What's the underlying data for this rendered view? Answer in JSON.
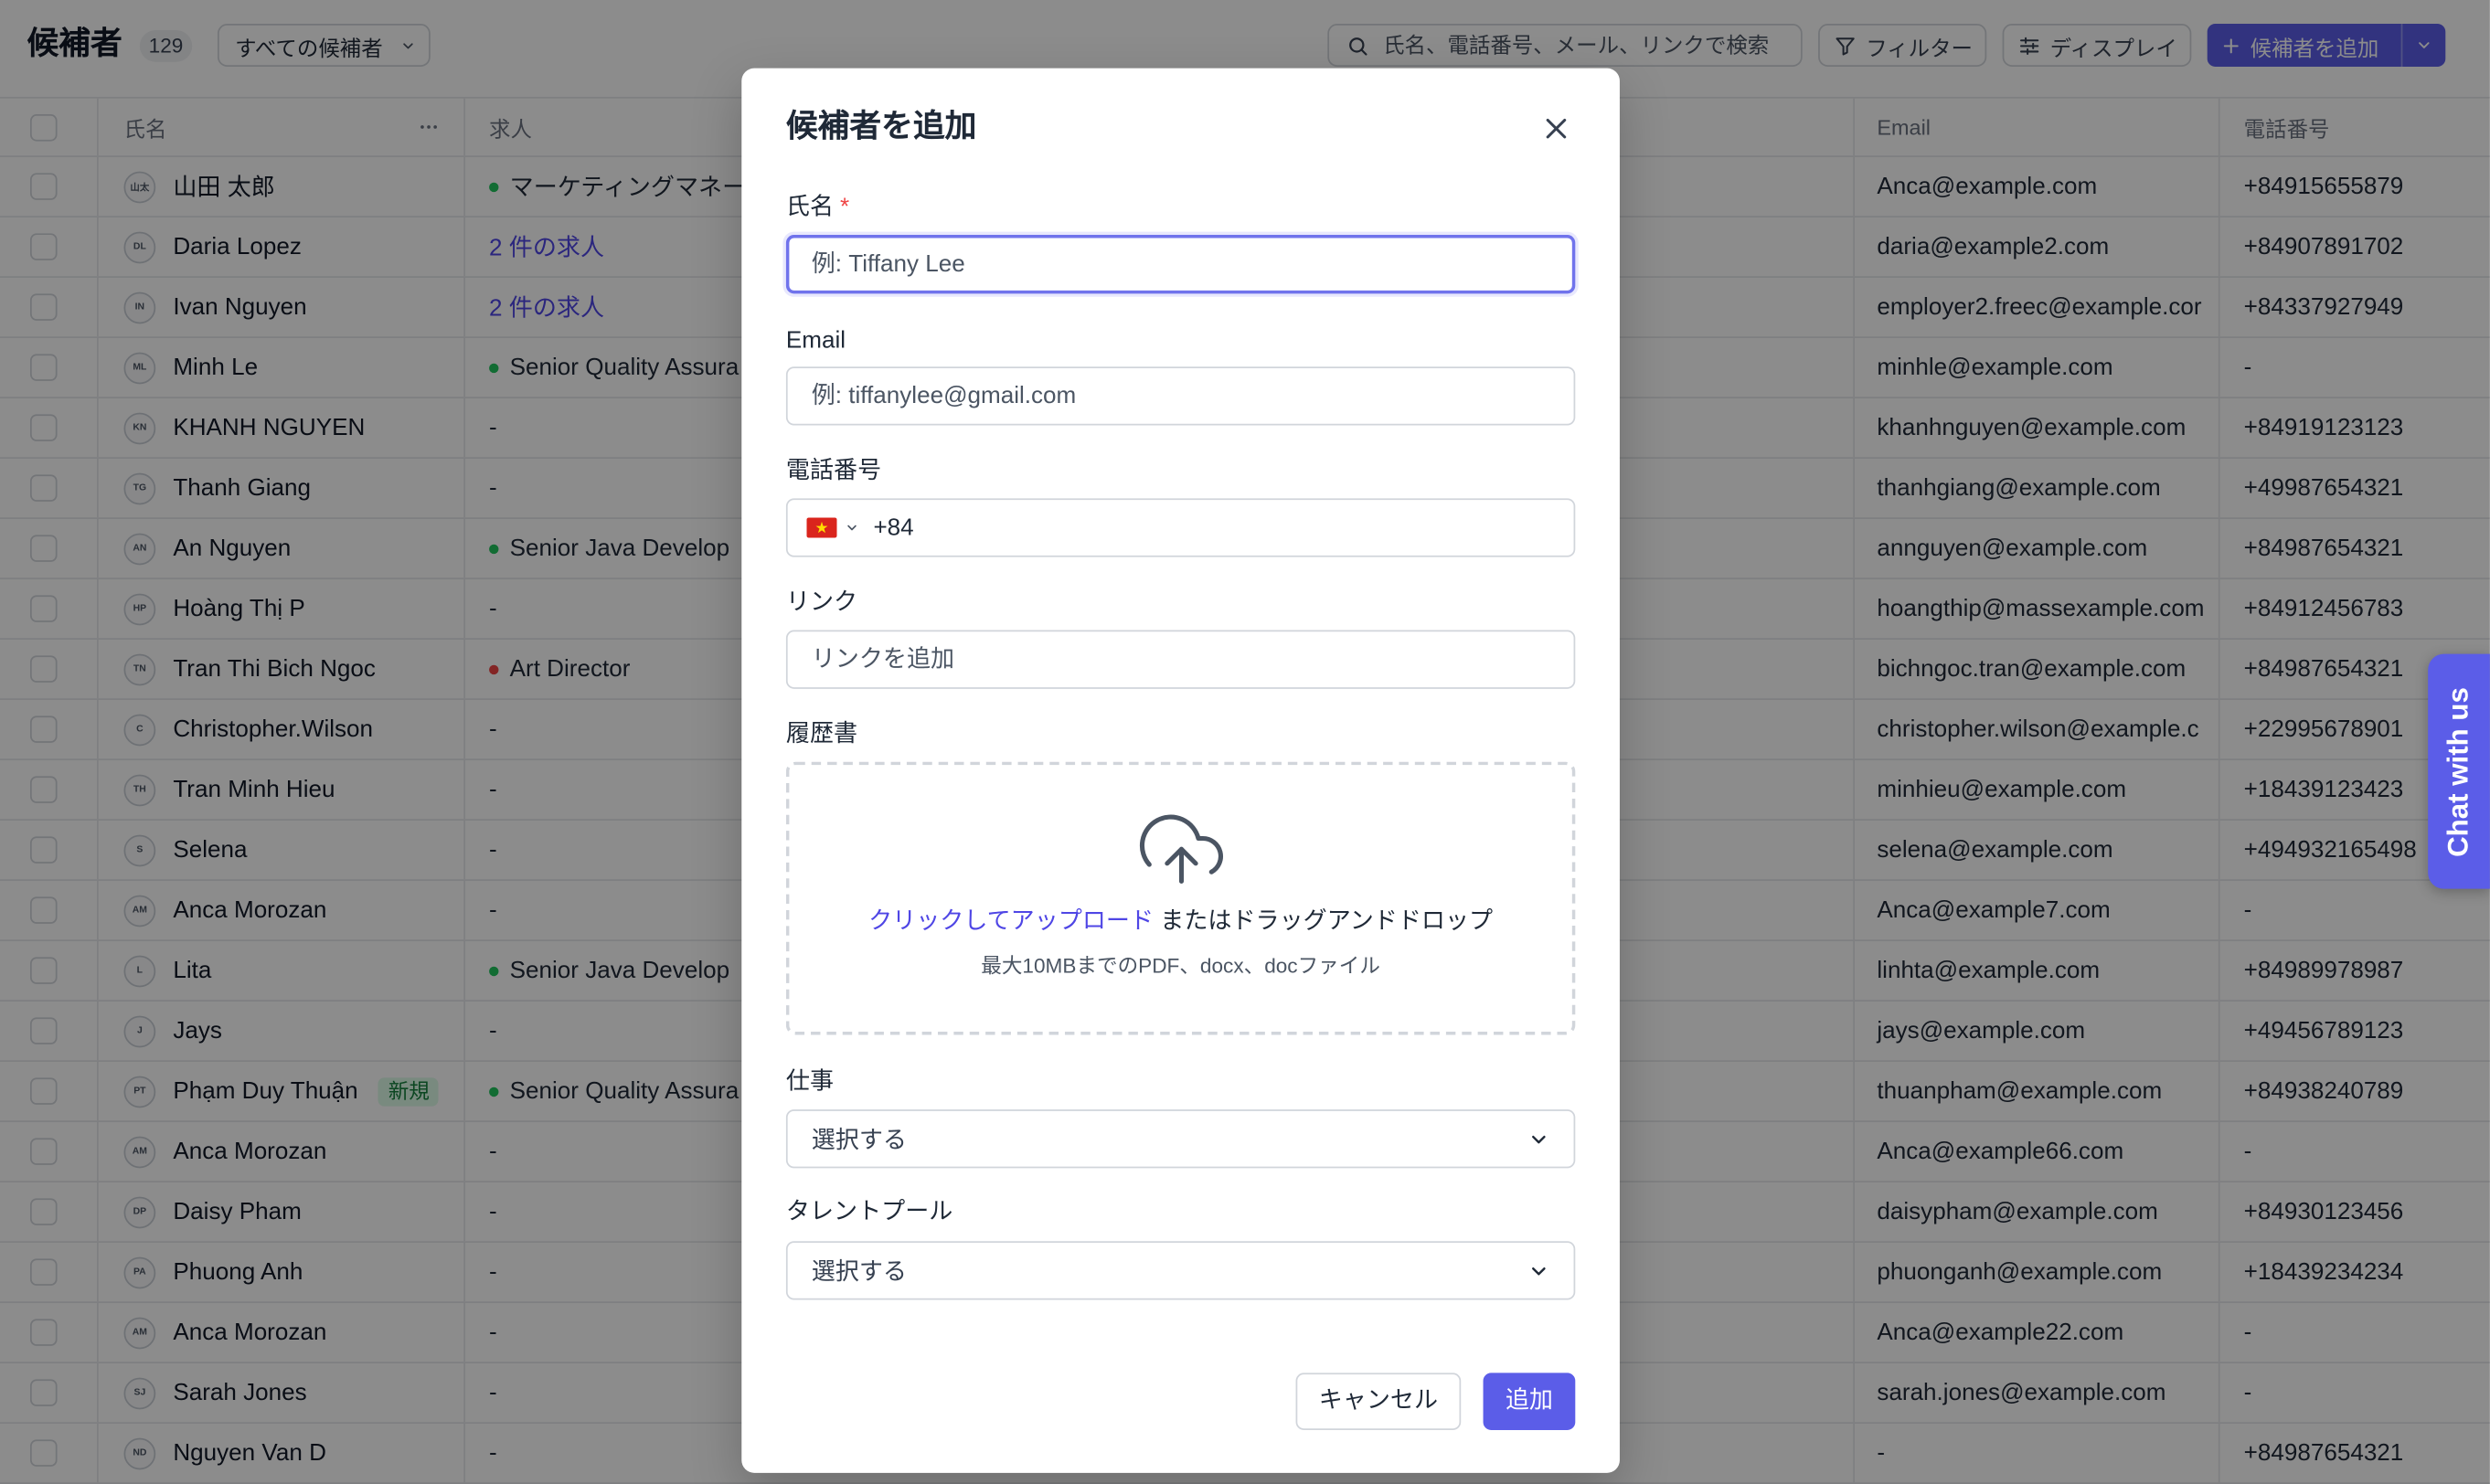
{
  "colors": {
    "accent": "#5b5de8"
  },
  "header": {
    "title": "候補者",
    "count": "129",
    "view_select": "すべての候補者",
    "search_placeholder": "氏名、電話番号、メール、リンクで検索",
    "filter_label": "フィルター",
    "display_label": "ディスプレイ",
    "add_label": "候補者を追加"
  },
  "table": {
    "columns": {
      "name": "氏名",
      "job": "求人",
      "email": "Email",
      "phone": "電話番号"
    },
    "rows": [
      {
        "initials": "山太",
        "name": "山田 太郎",
        "job": "マーケティングマネー",
        "job_dot": "#22c55e",
        "email": "Anca@example.com",
        "phone": "+84915655879"
      },
      {
        "initials": "DL",
        "name": "Daria Lopez",
        "job": "2 件の求人",
        "job_color": "#4f46e5",
        "email": "daria@example2.com",
        "phone": "+84907891702"
      },
      {
        "initials": "IN",
        "name": "Ivan Nguyen",
        "job": "2 件の求人",
        "job_color": "#4f46e5",
        "email": "employer2.freec@example.cor",
        "phone": "+84337927949"
      },
      {
        "initials": "ML",
        "name": "Minh Le",
        "job": "Senior Quality Assura",
        "job_dot": "#22c55e",
        "email": "minhle@example.com",
        "phone": "-"
      },
      {
        "initials": "KN",
        "name": "KHANH NGUYEN",
        "job": "-",
        "email": "khanhnguyen@example.com",
        "phone": "+84919123123"
      },
      {
        "initials": "TG",
        "name": "Thanh Giang",
        "job": "-",
        "email": "thanhgiang@example.com",
        "phone": "+49987654321"
      },
      {
        "initials": "AN",
        "name": "An Nguyen",
        "job": "Senior Java Develop",
        "job_dot": "#22c55e",
        "email": "annguyen@example.com",
        "phone": "+84987654321"
      },
      {
        "initials": "HP",
        "name": "Hoàng Thị P",
        "job": "-",
        "email": "hoangthip@massexample.com",
        "phone": "+84912456783"
      },
      {
        "initials": "TN",
        "name": "Tran Thi Bich Ngoc",
        "job": "Art Director",
        "job_dot": "#ef4444",
        "email": "bichngoc.tran@example.com",
        "phone": "+84987654321"
      },
      {
        "initials": "C",
        "name": "Christopher.Wilson",
        "job": "-",
        "email": "christopher.wilson@example.c",
        "phone": "+22995678901"
      },
      {
        "initials": "TH",
        "name": "Tran Minh Hieu",
        "job": "-",
        "email": "minhieu@example.com",
        "phone": "+18439123423"
      },
      {
        "initials": "S",
        "name": "Selena",
        "job": "-",
        "email": "selena@example.com",
        "phone": "+494932165498"
      },
      {
        "initials": "AM",
        "name": "Anca Morozan",
        "job": "-",
        "email": "Anca@example7.com",
        "phone": "-"
      },
      {
        "initials": "L",
        "name": "Lita",
        "job": "Senior Java Develop",
        "job_dot": "#22c55e",
        "email": "linhta@example.com",
        "phone": "+84989978987"
      },
      {
        "initials": "J",
        "name": "Jays",
        "job": "-",
        "email": "jays@example.com",
        "phone": "+49456789123"
      },
      {
        "initials": "PT",
        "name": "Phạm Duy Thuận",
        "badge": "新規",
        "job": "Senior Quality Assura",
        "job_dot": "#22c55e",
        "email": "thuanpham@example.com",
        "phone": "+84938240789"
      },
      {
        "initials": "AM",
        "name": "Anca Morozan",
        "job": "-",
        "email": "Anca@example66.com",
        "phone": "-"
      },
      {
        "initials": "DP",
        "name": "Daisy Pham",
        "job": "-",
        "email": "daisypham@example.com",
        "phone": "+84930123456"
      },
      {
        "initials": "PA",
        "name": "Phuong Anh",
        "job": "-",
        "email": "phuonganh@example.com",
        "phone": "+18439234234"
      },
      {
        "initials": "AM",
        "name": "Anca Morozan",
        "job": "-",
        "email": "Anca@example22.com",
        "phone": "-"
      },
      {
        "initials": "SJ",
        "name": "Sarah Jones",
        "job": "-",
        "email": "sarah.jones@example.com",
        "phone": "-"
      },
      {
        "initials": "ND",
        "name": "Nguyen Van D",
        "job": "-",
        "email": "-",
        "phone": "+84987654321"
      }
    ]
  },
  "modal": {
    "title": "候補者を追加",
    "name_label": "氏名",
    "required_mark": "*",
    "name_placeholder": "例: Tiffany Lee",
    "email_label": "Email",
    "email_placeholder": "例: tiffanylee@gmail.com",
    "phone_label": "電話番号",
    "phone_code": "+84",
    "link_label": "リンク",
    "link_placeholder": "リンクを追加",
    "resume_label": "履歴書",
    "upload_link": "クリックしてアップロード",
    "upload_text": " またはドラッグアンドドロップ",
    "upload_hint": "最大10MBまでのPDF、docx、docファイル",
    "job_label": "仕事",
    "job_value": "選択する",
    "pool_label": "タレントプール",
    "pool_value": "選択する",
    "cancel": "キャンセル",
    "submit": "追加"
  },
  "chat": {
    "label": "Chat with us"
  }
}
